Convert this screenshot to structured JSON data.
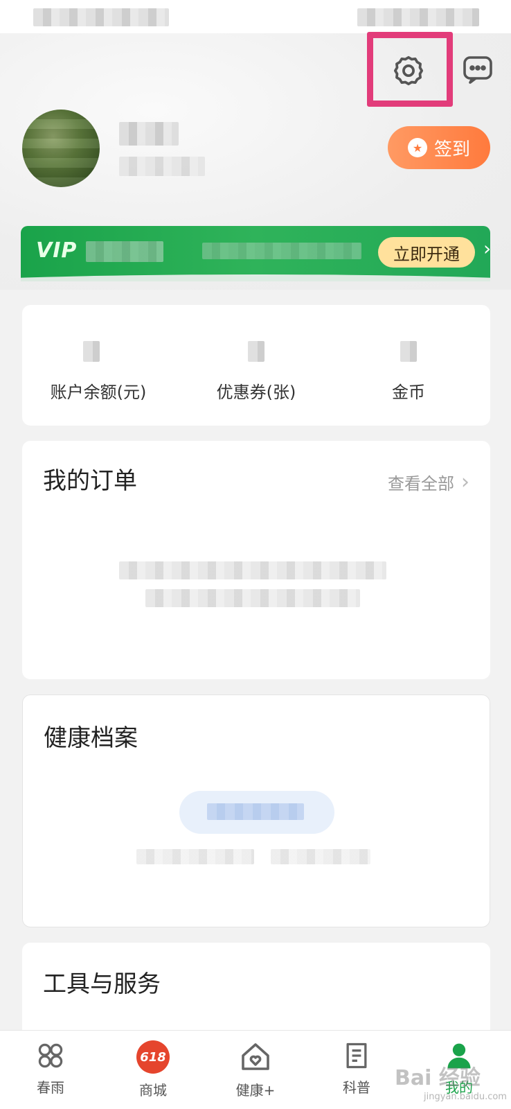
{
  "header": {
    "settings_icon": "gear-icon",
    "message_icon": "chat-bubble-icon",
    "signin_label": "签到"
  },
  "vip": {
    "logo": "VIP",
    "open_label": "立即开通",
    "arrow": "›"
  },
  "stats": [
    {
      "label": "账户余额(元)"
    },
    {
      "label": "优惠券(张)"
    },
    {
      "label": "金币"
    }
  ],
  "orders": {
    "title": "我的订单",
    "view_all": "查看全部",
    "chevron": "›"
  },
  "health": {
    "title": "健康档案"
  },
  "tools": {
    "title": "工具与服务"
  },
  "tabbar": {
    "items": [
      {
        "label": "春雨",
        "icon": "grid-icon"
      },
      {
        "label": "商城",
        "icon": "badge-618-icon",
        "badge": "618"
      },
      {
        "label": "健康+",
        "icon": "home-heart-icon"
      },
      {
        "label": "科普",
        "icon": "document-icon"
      },
      {
        "label": "我的",
        "icon": "profile-icon"
      }
    ]
  },
  "watermark": {
    "text": "Bai 经验",
    "sub": "jingyan.baidu.com"
  },
  "colors": {
    "brand_green": "#1aa34a",
    "signin_orange": "#ff7a3d",
    "highlight": "#e23c7a",
    "vip_gold": "#ffe19c"
  }
}
